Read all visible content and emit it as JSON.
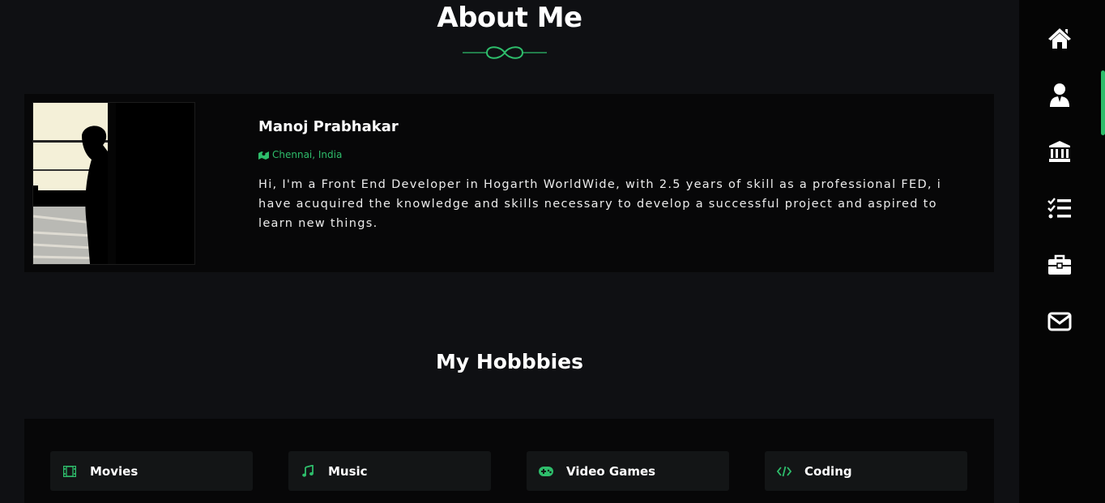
{
  "about": {
    "title": "About Me",
    "name": "Manoj Prabhakar",
    "location": "Chennai, India",
    "bio": "Hi, I'm a Front End Developer in Hogarth WorldWide, with 2.5 years of skill as a professional FED, i have acuquired the knowledge and skills necessary to develop a successful project and aspired to learn new things."
  },
  "hobbies": {
    "title": "My Hobbbies",
    "items": [
      {
        "label": "Movies",
        "icon": "film-icon"
      },
      {
        "label": "Music",
        "icon": "music-note-icon"
      },
      {
        "label": "Video Games",
        "icon": "gamepad-icon"
      },
      {
        "label": "Coding",
        "icon": "code-icon"
      }
    ]
  },
  "sidebar": {
    "items": [
      {
        "icon": "home-icon"
      },
      {
        "icon": "user-icon"
      },
      {
        "icon": "bank-icon"
      },
      {
        "icon": "task-list-icon"
      },
      {
        "icon": "briefcase-icon"
      },
      {
        "icon": "envelope-icon"
      }
    ]
  },
  "colors": {
    "accent": "#2ebd6b",
    "background": "#0f1013",
    "card": "#070708",
    "sidebar": "#050505"
  }
}
